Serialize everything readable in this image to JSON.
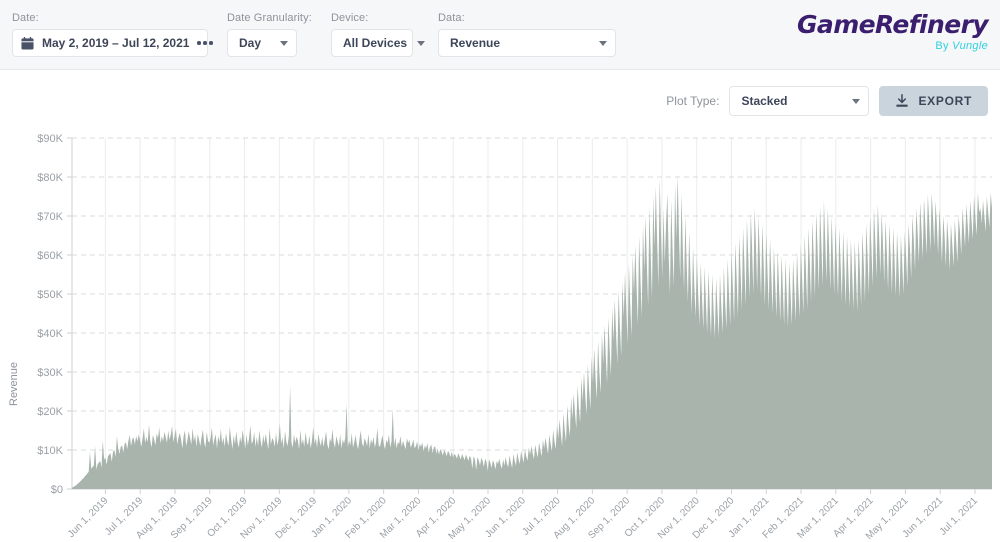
{
  "header": {
    "date": {
      "label": "Date:",
      "icon": "calendar-icon",
      "value": "May 2, 2019  –  Jul 12, 2021",
      "more": "more-options-icon"
    },
    "granularity": {
      "label": "Date Granularity:",
      "value": "Day"
    },
    "device": {
      "label": "Device:",
      "value": "All Devices"
    },
    "data": {
      "label": "Data:",
      "value": "Revenue"
    },
    "logo": {
      "main": "GameRefinery",
      "sub_prefix": "By",
      "sub_brand": "Vungle"
    }
  },
  "toolbar": {
    "plot_type_label": "Plot Type:",
    "plot_type_value": "Stacked",
    "export_label": "EXPORT",
    "export_icon": "download-icon"
  },
  "colors": {
    "area_fill": "#a8b4ac",
    "logo_purple": "#3b1e6e",
    "logo_cyan": "#2fd0e0",
    "export_bg": "#c9d4dd",
    "text_dark": "#3d4559",
    "text_muted": "#8d939b"
  },
  "chart_data": {
    "type": "area",
    "title": "",
    "xlabel": "",
    "ylabel": "Revenue",
    "ylim": [
      0,
      90000
    ],
    "yticks": [
      0,
      10000,
      20000,
      30000,
      40000,
      50000,
      60000,
      70000,
      80000,
      90000
    ],
    "ytick_labels": [
      "$0",
      "$10K",
      "$20K",
      "$30K",
      "$40K",
      "$50K",
      "$60K",
      "$70K",
      "$80K",
      "$90K"
    ],
    "grid": {
      "horizontal": true,
      "vertical": true
    },
    "legend": "none",
    "stacked": true,
    "granularity": "Day",
    "x_range": [
      "May 2, 2019",
      "Jul 12, 2021"
    ],
    "xtick_labels": [
      "Jun 1, 2019",
      "Jul 1, 2019",
      "Aug 1, 2019",
      "Sep 1, 2019",
      "Oct 1, 2019",
      "Nov 1, 2019",
      "Dec 1, 2019",
      "Jan 1, 2020",
      "Feb 1, 2020",
      "Mar 1, 2020",
      "Apr 1, 2020",
      "May 1, 2020",
      "Jun 1, 2020",
      "Jul 1, 2020",
      "Aug 1, 2020",
      "Sep 1, 2020",
      "Oct 1, 2020",
      "Nov 1, 2020",
      "Dec 1, 2020",
      "Jan 1, 2021",
      "Feb 1, 2021",
      "Mar 1, 2021",
      "Apr 1, 2021",
      "May 1, 2021",
      "Jun 1, 2021",
      "Jul 1, 2021"
    ],
    "series": [
      {
        "name": "Revenue",
        "color": "#a8b4ac",
        "values": [
          300,
          500,
          700,
          900,
          1200,
          1500,
          1800,
          2100,
          2500,
          2800,
          3200,
          3600,
          4000,
          4400,
          9500,
          5200,
          5600,
          6000,
          11000,
          5000,
          6400,
          6800,
          7200,
          5500,
          12500,
          7600,
          8000,
          6200,
          8400,
          8800,
          9200,
          7000,
          9600,
          10000,
          8200,
          13500,
          10400,
          9000,
          10800,
          11200,
          9400,
          11600,
          12000,
          10200,
          12400,
          13800,
          11000,
          12800,
          13200,
          11400,
          13600,
          12200,
          14000,
          12600,
          10800,
          13000,
          15500,
          11800,
          13400,
          12000,
          16500,
          12400,
          10600,
          13800,
          12800,
          11200,
          14200,
          13000,
          15800,
          11600,
          13600,
          12200,
          14600,
          13400,
          11800,
          15000,
          12600,
          14000,
          16200,
          12000,
          13800,
          15400,
          11400,
          13200,
          14400,
          12800,
          10400,
          13600,
          15000,
          11000,
          12600,
          14800,
          13000,
          11400,
          15600,
          12200,
          13800,
          10800,
          14200,
          12600,
          11000,
          13400,
          15200,
          12000,
          10600,
          14600,
          12400,
          11800,
          13000,
          15800,
          11200,
          12800,
          14000,
          10400,
          13600,
          12000,
          15400,
          11600,
          13200,
          10800,
          14400,
          12400,
          11000,
          16000,
          12800,
          10200,
          13800,
          11400,
          14800,
          12000,
          10600,
          13400,
          11800,
          15200,
          12600,
          10400,
          14000,
          11200,
          13000,
          16400,
          11600,
          12200,
          14600,
          10800,
          13400,
          11000,
          15000,
          12400,
          10600,
          13800,
          11800,
          14200,
          12000,
          10200,
          15600,
          11400,
          13000,
          12600,
          10800,
          14400,
          11200,
          12800,
          16800,
          11600,
          13200,
          10400,
          14800,
          12200,
          11000,
          13600,
          26500,
          12000,
          10600,
          14000,
          11800,
          13400,
          12400,
          10200,
          15200,
          11400,
          12800,
          10800,
          14600,
          12000,
          11200,
          13800,
          10400,
          12400,
          15800,
          11600,
          13000,
          10600,
          14200,
          12200,
          11000,
          13400,
          10800,
          12600,
          14800,
          11400,
          10200,
          13000,
          12000,
          15400,
          11800,
          10600,
          13600,
          12200,
          11000,
          14000,
          10400,
          12800,
          11600,
          13200,
          21800,
          10800,
          12400,
          11200,
          14400,
          10600,
          12000,
          13800,
          11400,
          10200,
          12600,
          15000,
          11800,
          10800,
          13000,
          12200,
          11000,
          14200,
          10400,
          12800,
          11600,
          13400,
          10600,
          12000,
          15600,
          11200,
          10800,
          12400,
          13800,
          11400,
          10200,
          12600,
          11800,
          14000,
          10600,
          12200,
          20600,
          11000,
          13200,
          10400,
          12000,
          11600,
          13600,
          10800,
          12400,
          11200,
          10200,
          13000,
          11800,
          12600,
          10600,
          11400,
          12800,
          10400,
          11000,
          12200,
          9800,
          11600,
          10800,
          12000,
          9600,
          11200,
          10400,
          11800,
          9400,
          10800,
          11400,
          9200,
          10600,
          11000,
          9000,
          10400,
          8800,
          10200,
          9600,
          8600,
          10000,
          9400,
          8400,
          9800,
          9200,
          8200,
          9600,
          8000,
          9000,
          8600,
          7800,
          9200,
          8400,
          7600,
          9000,
          8200,
          7400,
          8800,
          8000,
          7200,
          8600,
          7800,
          5200,
          8400,
          7600,
          4800,
          8200,
          7400,
          6000,
          8000,
          7200,
          5600,
          7800,
          7000,
          4600,
          7600,
          6800,
          5400,
          7400,
          6600,
          5000,
          7200,
          6400,
          7800,
          6200,
          5200,
          7600,
          6000,
          8200,
          6400,
          5600,
          8600,
          6800,
          5400,
          9000,
          7200,
          6000,
          9400,
          7600,
          6400,
          9800,
          8000,
          6800,
          10200,
          8400,
          7200,
          10600,
          8800,
          11000,
          9200,
          7600,
          11400,
          9600,
          8000,
          12000,
          10000,
          8400,
          12600,
          10400,
          13200,
          11000,
          9000,
          14000,
          11600,
          9600,
          15200,
          12200,
          10200,
          16400,
          13000,
          17800,
          14000,
          11000,
          19500,
          15000,
          12000,
          21500,
          16500,
          13500,
          23500,
          18000,
          24500,
          19500,
          15500,
          26500,
          21000,
          17000,
          28500,
          22500,
          30000,
          24000,
          19000,
          32000,
          25500,
          20500,
          34000,
          27000,
          36000,
          28500,
          23000,
          38000,
          30000,
          24500,
          40000,
          32000,
          42000,
          34000,
          27000,
          44000,
          36000,
          29000,
          46500,
          38000,
          48500,
          40000,
          32000,
          51000,
          42000,
          34000,
          53000,
          44000,
          55500,
          46000,
          37000,
          58000,
          48000,
          39000,
          60000,
          50000,
          62500,
          52000,
          42000,
          65000,
          54000,
          44000,
          67500,
          56000,
          70000,
          58000,
          47000,
          72500,
          60000,
          49000,
          75000,
          62000,
          77500,
          64000,
          52000,
          79500,
          66000,
          54000,
          72000,
          58000,
          68000,
          76000,
          60000,
          50000,
          74000,
          62000,
          52000,
          78000,
          64000,
          80500,
          66000,
          54000,
          76000,
          62000,
          51000,
          70000,
          58000,
          48000,
          66000,
          55000,
          45000,
          62000,
          52000,
          44000,
          60000,
          50000,
          42000,
          58000,
          49000,
          41000,
          57000,
          48000,
          40000,
          56000,
          47000,
          39000,
          55000,
          46000,
          38500,
          54000,
          46500,
          39000,
          55000,
          47000,
          40000,
          57000,
          48000,
          41000,
          59000,
          50000,
          42000,
          61000,
          52000,
          43000,
          63000,
          54000,
          44000,
          65000,
          56000,
          46000,
          67000,
          58000,
          47000,
          69000,
          60000,
          49000,
          71000,
          62000,
          50000,
          72000,
          63000,
          51000,
          70000,
          60000,
          49000,
          68000,
          58000,
          47000,
          66000,
          56000,
          46000,
          64000,
          55000,
          45000,
          62000,
          53000,
          44000,
          61000,
          52000,
          43000,
          60000,
          51000,
          42000,
          59000,
          50000,
          41500,
          58000,
          50000,
          42000,
          59000,
          51000,
          43000,
          61000,
          52000,
          44000,
          63000,
          54000,
          45000,
          65000,
          56000,
          46000,
          67000,
          58000,
          48000,
          69000,
          60000,
          49000,
          71000,
          62000,
          51000,
          72500,
          63000,
          52000,
          74000,
          64000,
          53000,
          72000,
          62000,
          51000,
          70000,
          60000,
          50000,
          68000,
          59000,
          49000,
          67000,
          58000,
          48000,
          66000,
          57000,
          47000,
          65000,
          56000,
          46500,
          64000,
          55500,
          46000,
          63500,
          55000,
          45500,
          64000,
          56000,
          47000,
          66000,
          58000,
          48000,
          68000,
          60000,
          50000,
          70000,
          62000,
          52000,
          72000,
          64000,
          54000,
          73000,
          65000,
          55000,
          71000,
          63000,
          53000,
          69000,
          61000,
          51000,
          68000,
          60000,
          50000,
          67000,
          59000,
          49500,
          66000,
          58000,
          49000,
          65000,
          58000,
          50000,
          66000,
          60000,
          52000,
          68000,
          62000,
          54000,
          70000,
          64000,
          56000,
          72000,
          66000,
          58000,
          73500,
          67000,
          59000,
          74500,
          68000,
          60000,
          75500,
          69000,
          61000,
          76000,
          70000,
          62000,
          74000,
          68000,
          60000,
          72000,
          66000,
          58000,
          70000,
          65000,
          57000,
          69000,
          64000,
          56000,
          68000,
          63000,
          57000,
          69000,
          64000,
          58000,
          70000,
          66000,
          60000,
          72000,
          67000,
          62000,
          73000,
          68000,
          63000,
          74000,
          69000,
          64000,
          75000,
          70000,
          65000,
          76000,
          71000,
          72000,
          68000,
          74000,
          70000,
          66000,
          75000,
          71000,
          67000,
          76000,
          72000
        ]
      }
    ]
  }
}
